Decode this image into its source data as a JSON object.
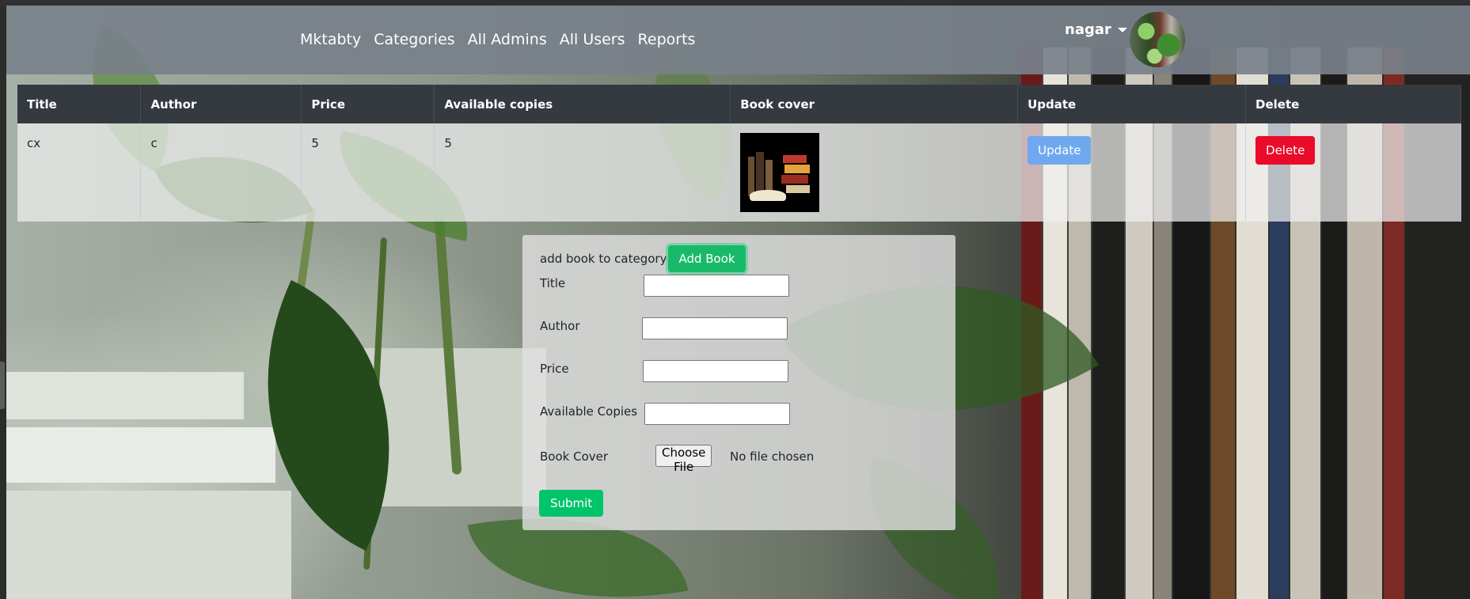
{
  "navbar": {
    "links": [
      "Mktabty",
      "Categories",
      "All Admins",
      "All Users",
      "Reports"
    ],
    "username": "nagar"
  },
  "table": {
    "headers": [
      "Title",
      "Author",
      "Price",
      "Available copies",
      "Book cover",
      "Update",
      "Delete"
    ],
    "rows": [
      {
        "title": "cx",
        "author": "c",
        "price": "5",
        "copies": "5",
        "update_label": "Update",
        "delete_label": "Delete"
      }
    ]
  },
  "form": {
    "heading": "add book to category",
    "add_button": "Add Book",
    "fields": {
      "title": "Title",
      "author": "Author",
      "price": "Price",
      "copies": "Available Copies",
      "cover": "Book Cover"
    },
    "file_button": "Choose File",
    "file_status": "No file chosen",
    "submit": "Submit"
  },
  "colors": {
    "navbar": "#78808a",
    "table_header": "#343a40",
    "update": "#6fa8ef",
    "delete": "#ea0a2a",
    "add": "#19b96a",
    "submit": "#00c46a"
  }
}
